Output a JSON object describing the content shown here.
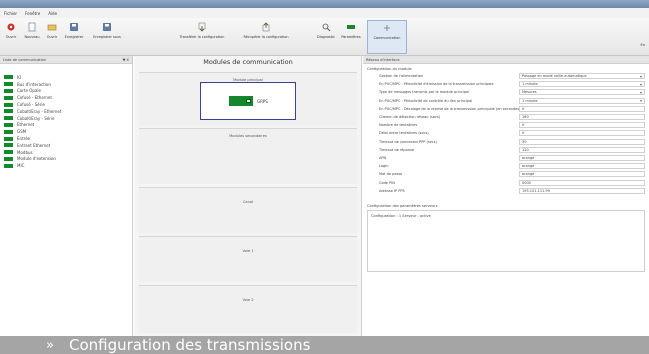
{
  "menu": [
    "Fichier",
    "Fenêtre",
    "Aide"
  ],
  "toolbar": [
    {
      "label": "Ouvrir",
      "icon": "red-gear-icon"
    },
    {
      "label": "Nouveau",
      "icon": "new-file-icon"
    },
    {
      "label": "Ouvrir",
      "icon": "open-icon"
    },
    {
      "label": "Enregistrer",
      "icon": "save-icon"
    },
    {
      "label": "Enregistrer sous",
      "icon": "save-as-icon"
    },
    {
      "label": "Transférer la configuration",
      "icon": "transfer-icon"
    },
    {
      "label": "Récupérer la configuration",
      "icon": "receive-icon"
    },
    {
      "label": "Diagnostic",
      "icon": "diagnostic-icon"
    },
    {
      "label": "Paramètres",
      "icon": "settings-icon"
    },
    {
      "label": "Communication",
      "icon": "communication-icon"
    }
  ],
  "toolbar_right": "En",
  "left_panel": {
    "title": "Liste de communication",
    "pin": "▼ X",
    "items": [
      "IO",
      "Bus d'interaction",
      "Carte Opale",
      "Cofusé - Ethernet",
      "Cofusé - Série",
      "Cobalt/Eray - Ethernet",
      "Cobalt/Eray - Série",
      "Ethernet",
      "GSM",
      "Entrée",
      "Entrant Ethernet",
      "Modbus",
      "Module d'extension",
      "MIC"
    ]
  },
  "middle_panel": {
    "title": "Modules de communication",
    "sections": [
      "Module principal",
      "Modules secondaires",
      "Canal",
      "Voie 1",
      "Voie 2"
    ],
    "module_label": "GRPS"
  },
  "right_panel": {
    "title": "Réseau d'interface",
    "section_title": "Configuration du module",
    "section_subtitle": "Gestion de l'alimentation",
    "rows": [
      {
        "key": "Gestion de l'alimentation",
        "value": "Passage en mode veille automatique",
        "type": "drop"
      },
      {
        "key": "En PUC/MPC : Périodicité d'émission de la transmission principale",
        "value": "1 minute",
        "type": "drop"
      },
      {
        "key": "Type de messages transmis par le module principal",
        "value": "Mesures",
        "type": "drop"
      },
      {
        "key": "En PUC/MPC : Périodicité de contrôle du lien principal",
        "value": "1 minute",
        "type": "drop"
      },
      {
        "key": "En PUC/MPC : Décalage de la reprise de la transmission principale (en secondes au 1)",
        "value": "0",
        "type": "text"
      },
      {
        "key": "Chemin de détection réseau (secs)",
        "value": "180",
        "type": "text"
      },
      {
        "key": "Nombre de tentatives",
        "value": "0",
        "type": "text"
      },
      {
        "key": "Délai entre tentatives (secs)",
        "value": "0",
        "type": "text"
      },
      {
        "key": "Timeout de connexion PPP (secs)",
        "value": "30",
        "type": "text"
      },
      {
        "key": "Timeout de réponse",
        "value": "120",
        "type": "text"
      },
      {
        "key": "APN",
        "value": "orange",
        "type": "text"
      },
      {
        "key": "Login",
        "value": "orange",
        "type": "text"
      },
      {
        "key": "Mot de passe",
        "value": "orange",
        "type": "text"
      },
      {
        "key": "Code PIN",
        "value": "0000",
        "type": "text"
      },
      {
        "key": "Adresse IP PPS",
        "value": "195.101.111.99",
        "type": "text"
      }
    ],
    "status_section_title": "Configuration des paramètres serveurs",
    "status_text": "Configuration : 1 Serveur - active"
  },
  "caption": {
    "chevron": "»",
    "text": "Configuration des transmissions"
  }
}
